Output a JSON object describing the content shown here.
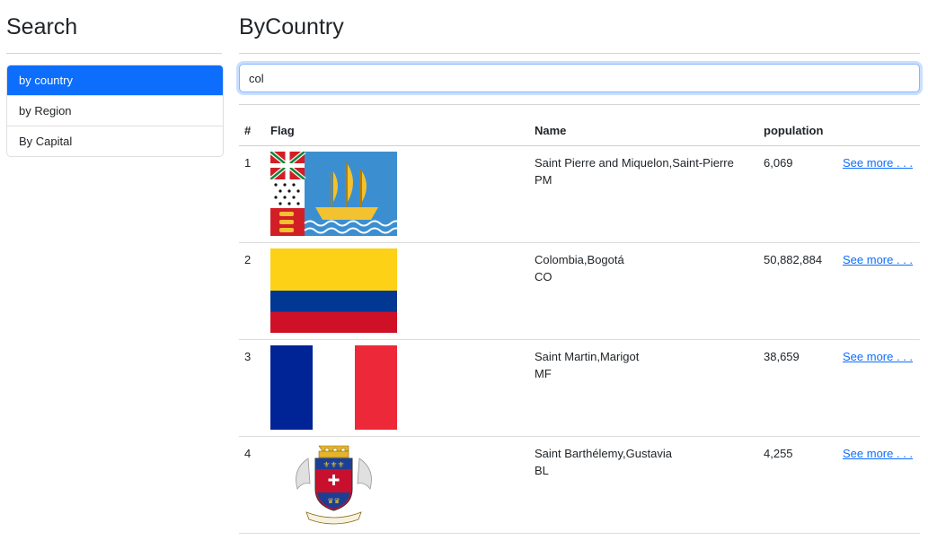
{
  "sidebar": {
    "title": "Search",
    "items": [
      {
        "label": "by country",
        "active": true
      },
      {
        "label": "by Region",
        "active": false
      },
      {
        "label": "By Capital",
        "active": false
      }
    ]
  },
  "main": {
    "title": "ByCountry",
    "search": {
      "value": "col"
    },
    "table": {
      "headers": [
        "#",
        "Flag",
        "Name",
        "population"
      ],
      "rows": [
        {
          "index": "1",
          "name": "Saint Pierre and Miquelon,Saint-Pierre",
          "code": "PM",
          "population": "6,069",
          "link": "See more . . ."
        },
        {
          "index": "2",
          "name": "Colombia,Bogotá",
          "code": "CO",
          "population": "50,882,884",
          "link": "See more . . ."
        },
        {
          "index": "3",
          "name": "Saint Martin,Marigot",
          "code": "MF",
          "population": "38,659",
          "link": "See more . . ."
        },
        {
          "index": "4",
          "name": "Saint Barthélemy,Gustavia",
          "code": "BL",
          "population": "4,255",
          "link": "See more . . ."
        }
      ]
    }
  },
  "colors": {
    "accent": "#0d6efd"
  }
}
